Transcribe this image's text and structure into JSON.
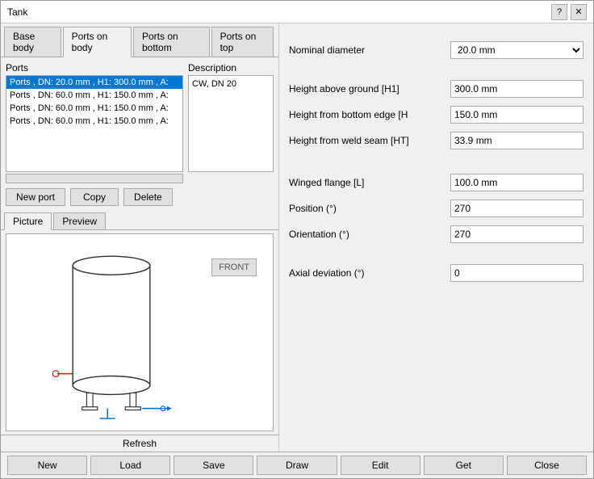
{
  "window": {
    "title": "Tank",
    "help_btn": "?",
    "close_btn": "✕"
  },
  "tabs": [
    {
      "label": "Base body",
      "active": false
    },
    {
      "label": "Ports on body",
      "active": true
    },
    {
      "label": "Ports on bottom",
      "active": false
    },
    {
      "label": "Ports on top",
      "active": false
    }
  ],
  "ports_section": {
    "ports_label": "Ports",
    "desc_label": "Description",
    "desc_value": "CW, DN 20",
    "port_items": [
      {
        "text": "Ports , DN: 20.0 mm , H1: 300.0 mm , A:",
        "selected": true
      },
      {
        "text": "Ports , DN: 60.0 mm , H1: 150.0 mm , A:",
        "selected": false
      },
      {
        "text": "Ports , DN: 60.0 mm , H1: 150.0 mm , A:",
        "selected": false
      },
      {
        "text": "Ports , DN: 60.0 mm , H1: 150.0 mm , A:",
        "selected": false
      }
    ],
    "new_port_btn": "New port",
    "copy_btn": "Copy",
    "delete_btn": "Delete"
  },
  "sub_tabs": [
    {
      "label": "Picture",
      "active": true
    },
    {
      "label": "Preview",
      "active": false
    }
  ],
  "preview": {
    "refresh_btn": "Refresh",
    "front_label": "FRONT"
  },
  "right_panel": {
    "nominal_diameter_label": "Nominal diameter",
    "nominal_diameter_value": "20.0 mm",
    "height_above_ground_label": "Height above ground [H1]",
    "height_above_ground_value": "300.0 mm",
    "height_from_bottom_label": "Height from bottom edge [H",
    "height_from_bottom_value": "150.0 mm",
    "height_from_weld_label": "Height from weld seam [HT]",
    "height_from_weld_value": "33.9 mm",
    "winged_flange_label": "Winged flange [L]",
    "winged_flange_value": "100.0 mm",
    "position_label": "Position (°)",
    "position_value": "270",
    "orientation_label": "Orientation (°)",
    "orientation_value": "270",
    "axial_deviation_label": "Axial deviation (°)",
    "axial_deviation_value": "0"
  },
  "bottom_bar": {
    "new_btn": "New",
    "load_btn": "Load",
    "save_btn": "Save",
    "draw_btn": "Draw",
    "edit_btn": "Edit",
    "get_btn": "Get",
    "close_btn": "Close"
  }
}
